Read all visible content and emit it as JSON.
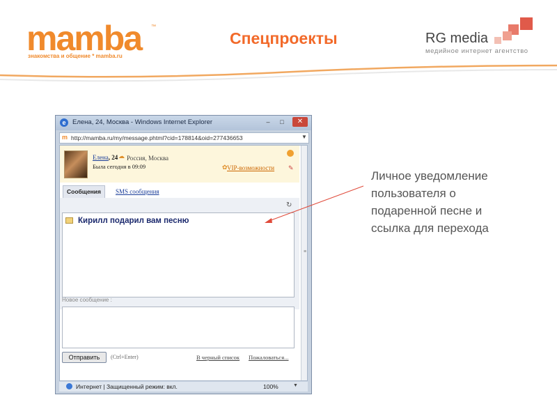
{
  "header": {
    "logo_text": "mamba",
    "logo_tm": "™",
    "logo_tagline": "знакомства и общение * mamba.ru",
    "title": "Спецпроекты",
    "rg_title": "RG media",
    "rg_subtitle": "медийное интернет агентство",
    "accent_color": "#f26a2a",
    "squares_color": "#e05a4a"
  },
  "window": {
    "title": "Елена, 24, Москва - Windows Internet Explorer",
    "minimize": "–",
    "maximize": "□",
    "close": "✕",
    "address": "http://mamba.ru/my/message.phtml?cid=178814&oid=277436653",
    "profile": {
      "name": "Елена",
      "age": ", 24",
      "location": "Россия, Москва",
      "last_seen": "Была сегодня в 09:09",
      "vip_link": "VIP-возможности"
    },
    "tabs": {
      "messages": "Сообщения",
      "sms": "SMS сообщения"
    },
    "message": {
      "text": "Кирилл подарил вам песню"
    },
    "compose": {
      "label": "Новое сообщение :",
      "send_button": "Отправить",
      "hint": "(Ctrl+Enter)",
      "blacklist_link": "В черный список",
      "complain_link": "Пожаловаться..."
    },
    "statusbar": {
      "text": "Интернет | Защищенный режим: вкл.",
      "zoom": "100%"
    }
  },
  "annotation": {
    "text": "Личное уведомление пользователя о подаренной песне и ссылка для перехода"
  }
}
